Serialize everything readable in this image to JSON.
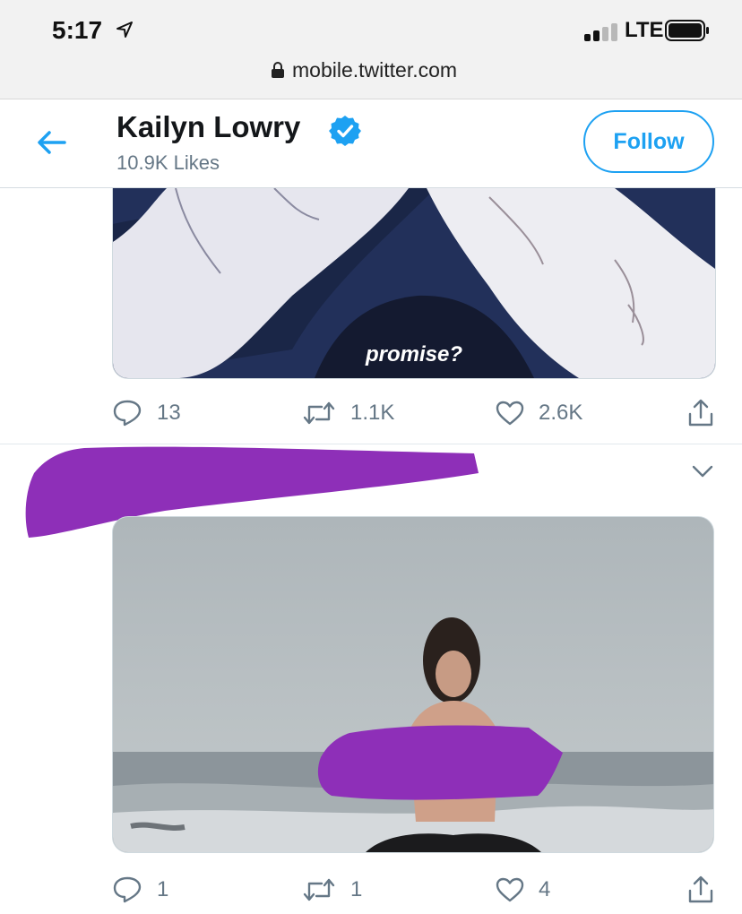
{
  "status_bar": {
    "time": "5:17",
    "network": "LTE",
    "url": "mobile.twitter.com"
  },
  "icons": {
    "location": "location-arrow-icon",
    "signal": "signal-bars-icon",
    "battery": "battery-icon",
    "lock": "lock-icon",
    "back": "back-arrow-icon",
    "verified": "verified-badge-icon",
    "reply": "reply-icon",
    "retweet": "retweet-icon",
    "like": "heart-icon",
    "share": "share-icon",
    "more": "chevron-down-icon"
  },
  "header": {
    "name": "Kailyn Lowry",
    "likes_count": "10.9K Likes",
    "follow_label": "Follow"
  },
  "tweets": [
    {
      "media_caption": "promise?",
      "replies": "13",
      "retweets": "1.1K",
      "likes": "2.6K"
    },
    {
      "replies": "1",
      "retweets": "1",
      "likes": "4"
    }
  ],
  "colors": {
    "accent": "#1da1f2",
    "muted_text": "#657786",
    "redaction": "#8e2fb8"
  }
}
